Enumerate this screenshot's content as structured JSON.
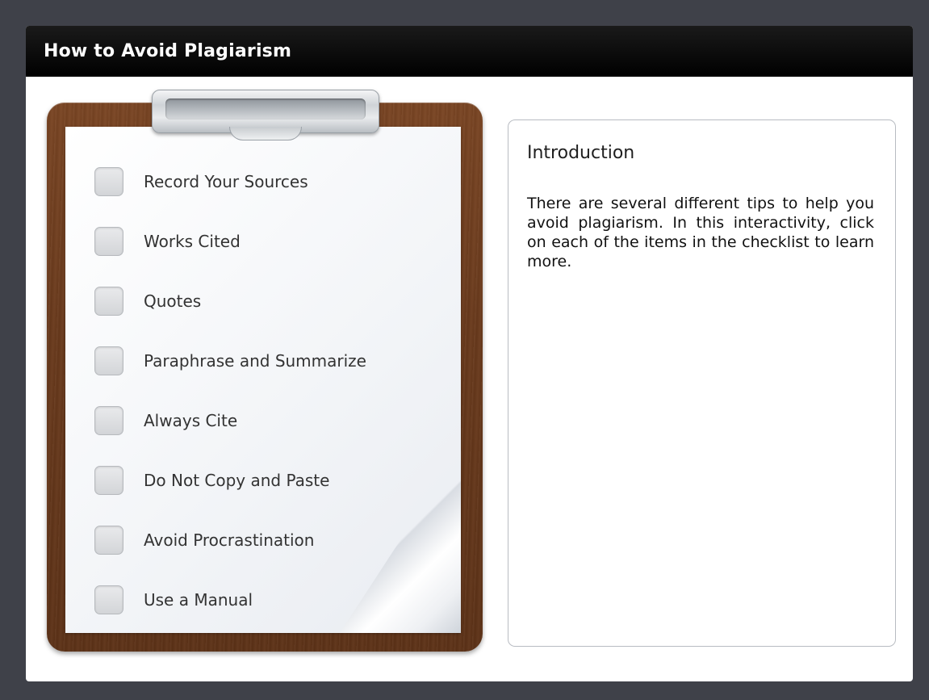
{
  "window": {
    "title": "How to Avoid Plagiarism"
  },
  "checklist": {
    "items": [
      {
        "label": "Record Your Sources",
        "checked": false
      },
      {
        "label": "Works Cited",
        "checked": false
      },
      {
        "label": "Quotes",
        "checked": false
      },
      {
        "label": "Paraphrase and Summarize",
        "checked": false
      },
      {
        "label": "Always Cite",
        "checked": false
      },
      {
        "label": "Do Not Copy and Paste",
        "checked": false
      },
      {
        "label": "Avoid Procrastination",
        "checked": false
      },
      {
        "label": "Use a Manual",
        "checked": false
      }
    ]
  },
  "info_panel": {
    "heading": "Introduction",
    "body": "There are several different tips to help you avoid plagiarism.  In this interactivity, click on each of the items in the checklist to learn more."
  },
  "colors": {
    "background": "#3f4149",
    "title_bar": "#000000",
    "title_text": "#ffffff",
    "clipboard_wood": "#6a3a1c",
    "panel_border": "#b8bcc2"
  }
}
